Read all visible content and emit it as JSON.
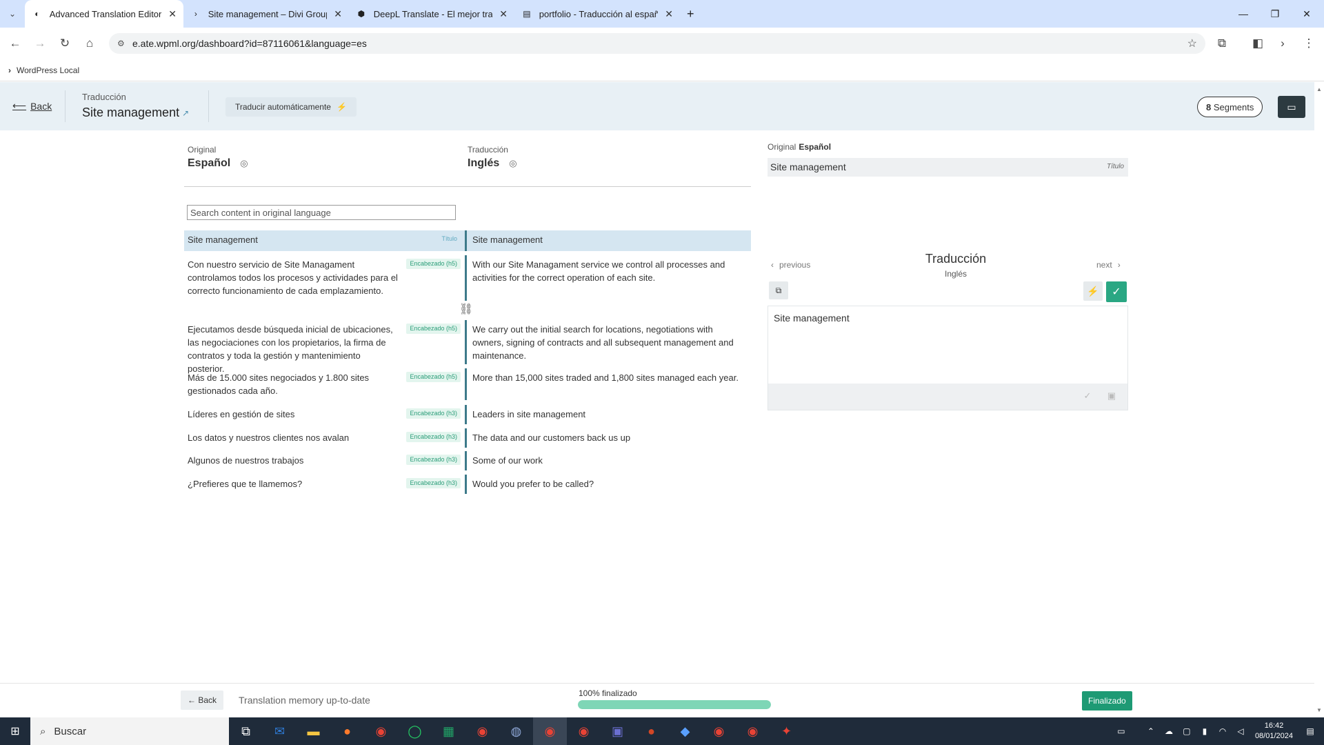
{
  "browser": {
    "tabs": [
      {
        "label": "Advanced Translation Editor - W",
        "icon": "wpml-icon"
      },
      {
        "label": "Site management – Divi Group",
        "icon": "chevron-icon"
      },
      {
        "label": "DeepL Translate - El mejor tradu",
        "icon": "deepl-icon"
      },
      {
        "label": "portfolio - Traducción al españo",
        "icon": "doc-icon"
      }
    ],
    "new_tab": "+",
    "url": "e.ate.wpml.org/dashboard?id=87116061&language=es",
    "bookmark": "WordPress Local"
  },
  "header": {
    "back": "Back",
    "subtitle": "Traducción",
    "title": "Site management",
    "auto_translate": "Traducir automáticamente",
    "segments_count": "8",
    "segments_label": " Segments"
  },
  "languages": {
    "original_label": "Original",
    "original_lang": "Español",
    "translation_label": "Traducción",
    "translation_lang": "Inglés"
  },
  "search": {
    "placeholder": "Search content in original language"
  },
  "segments": [
    {
      "original": "Site management",
      "tag": "Título",
      "translation": "Site management"
    },
    {
      "original": "Con nuestro servicio de Site Managament controlamos todos los procesos y actividades para el correcto funcionamiento de cada emplazamiento.",
      "tag": "Encabezado (h5)",
      "translation": "With our Site Managament service we control all processes and activities for the correct operation of each site."
    },
    {
      "original": "Ejecutamos desde búsqueda inicial de ubicaciones, las negociaciones con los propietarios, la firma de contratos y toda la gestión y mantenimiento posterior.",
      "tag": "Encabezado (h5)",
      "translation": "We carry out the initial search for locations, negotiations with owners, signing of contracts and all subsequent management and maintenance."
    },
    {
      "original": "Más de 15.000 sites negociados y 1.800 sites gestionados cada año.",
      "tag": "Encabezado (h5)",
      "translation": "More than 15,000 sites traded and 1,800 sites managed each year."
    },
    {
      "original": "Líderes en gestión de sites",
      "tag": "Encabezado (h3)",
      "translation": "Leaders in site management"
    },
    {
      "original": "Los datos y nuestros clientes nos avalan",
      "tag": "Encabezado (h3)",
      "translation": "The data and our customers back us up"
    },
    {
      "original": "Algunos de nuestros trabajos",
      "tag": "Encabezado (h3)",
      "translation": "Some of our work"
    },
    {
      "original": "¿Prefieres que te llamemos?",
      "tag": "Encabezado (h3)",
      "translation": "Would you prefer to be called?"
    }
  ],
  "right_panel": {
    "original_label": "Original",
    "original_lang": "Español",
    "original_text": "Site management",
    "original_tag": "Título",
    "previous": "previous",
    "next": "next",
    "title": "Traducción",
    "subtitle": "Inglés",
    "editor_text": "Site management"
  },
  "footer": {
    "back": "← Back",
    "memory_status": "Translation memory up-to-date",
    "progress_label": "100% finalizado",
    "progress_fraction": 1.0,
    "done": "Finalizado"
  },
  "taskbar": {
    "search": "Buscar",
    "time": "16:42",
    "date": "08/01/2024"
  },
  "colors": {
    "accent": "#2aa783",
    "header_bg": "#e8f0f5",
    "selected_row": "#d5e6f1",
    "divider": "#3d7a8a"
  }
}
